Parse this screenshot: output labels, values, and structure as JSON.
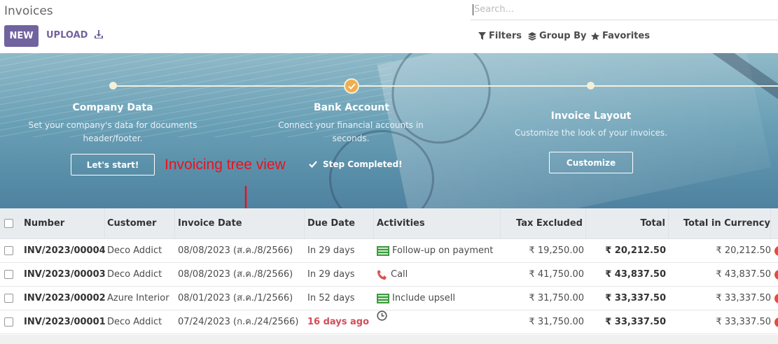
{
  "header": {
    "title": "Invoices",
    "new_label": "NEW",
    "upload_label": "UPLOAD",
    "search_placeholder": "Search...",
    "filters_label": "Filters",
    "groupby_label": "Group By",
    "favorites_label": "Favorites"
  },
  "onboarding": {
    "steps": [
      {
        "title": "Company Data",
        "desc_line1": "Set your company's data for documents",
        "desc_line2": "header/footer.",
        "action": "Let's start!"
      },
      {
        "title": "Bank Account",
        "desc_line1": "Connect your financial accounts in",
        "desc_line2": "seconds.",
        "action": "Step Completed!"
      },
      {
        "title": "Invoice Layout",
        "desc_line1": "Customize the look of your invoices.",
        "action": "Customize"
      }
    ],
    "annotation": "Invoicing tree view"
  },
  "table": {
    "columns": [
      "Number",
      "Customer",
      "Invoice Date",
      "Due Date",
      "Activities",
      "Tax Excluded",
      "Total",
      "Total in Currency"
    ],
    "rows": [
      {
        "number": "INV/2023/00004",
        "customer": "Deco Addict",
        "invoice_date": "08/08/2023 (ส.ค./8/2566)",
        "due": "In 29 days",
        "activity_icon": "bill-icon",
        "activity": "Follow-up on payment",
        "tax_excluded": "₹ 19,250.00",
        "total": "₹ 20,212.50",
        "total_currency": "₹ 20,212.50"
      },
      {
        "number": "INV/2023/00003",
        "customer": "Deco Addict",
        "invoice_date": "08/08/2023 (ส.ค./8/2566)",
        "due": "In 29 days",
        "activity_icon": "phone-icon",
        "activity": "Call",
        "tax_excluded": "₹ 41,750.00",
        "total": "₹ 43,837.50",
        "total_currency": "₹ 43,837.50"
      },
      {
        "number": "INV/2023/00002",
        "customer": "Azure Interior",
        "invoice_date": "08/01/2023 (ส.ค./1/2566)",
        "due": "In 52 days",
        "activity_icon": "bill-icon",
        "activity": "Include upsell",
        "tax_excluded": "₹ 31,750.00",
        "total": "₹ 33,337.50",
        "total_currency": "₹ 33,337.50"
      },
      {
        "number": "INV/2023/00001",
        "customer": "Deco Addict",
        "invoice_date": "07/24/2023 (ก.ค./24/2566)",
        "due": "16 days ago",
        "activity_icon": "clock-icon",
        "activity": "",
        "tax_excluded": "₹ 31,750.00",
        "total": "₹ 33,337.50",
        "total_currency": "₹ 33,337.50"
      }
    ]
  },
  "colors": {
    "primary": "#71639e",
    "overdue": "#d44c59",
    "annotation": "#e8121e",
    "step_done": "#f0ad4e"
  }
}
